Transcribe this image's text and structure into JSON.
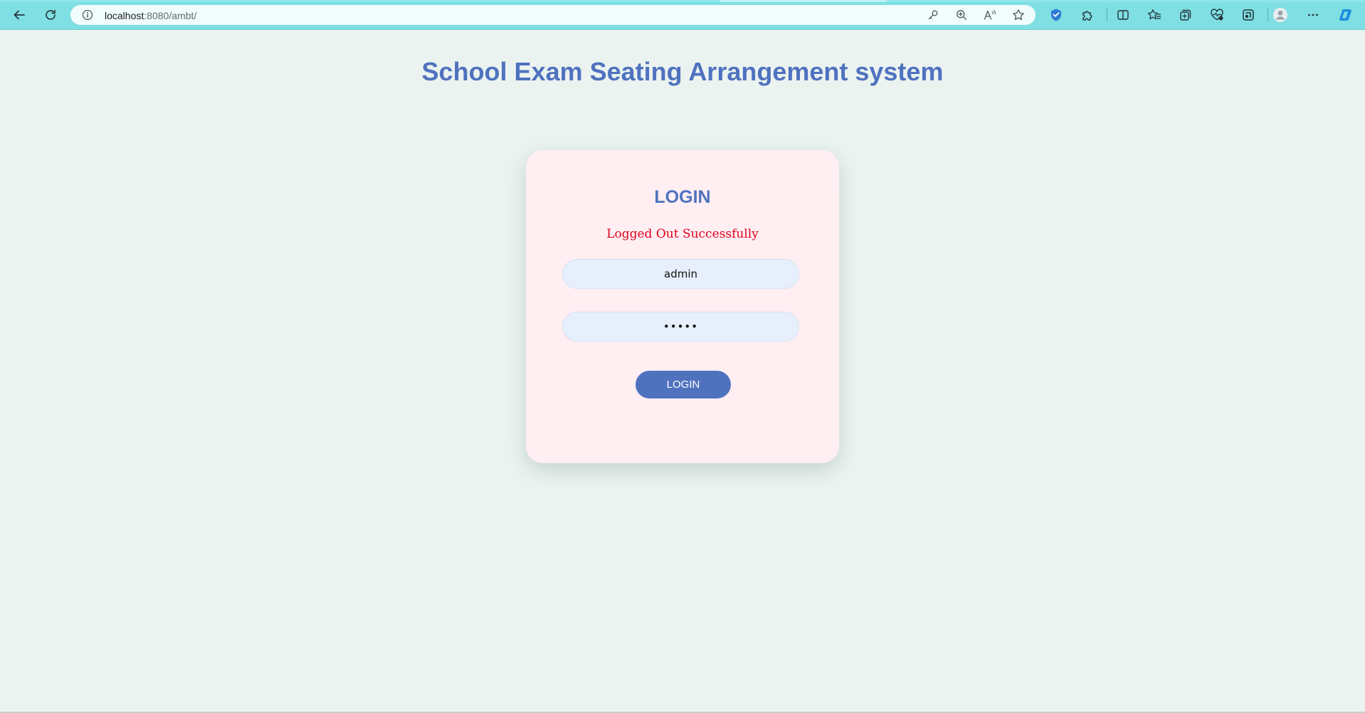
{
  "browser": {
    "url_host": "localhost",
    "url_path": ":8080/ambt/",
    "icons": {
      "back": "back-arrow-icon",
      "refresh": "refresh-icon",
      "site_info": "info-icon",
      "password": "key-icon",
      "zoom": "zoom-icon",
      "read_aloud": "read-aloud-icon",
      "favorite": "star-icon",
      "extension_shield": "extension-icon",
      "extensions": "puzzle-icon",
      "split_screen": "split-screen-icon",
      "favorites": "favorites-icon",
      "collections": "collections-icon",
      "browser_essentials": "heart-pulse-icon",
      "web_capture": "web-capture-icon",
      "profile": "profile-icon",
      "menu": "more-icon",
      "copilot": "copilot-icon"
    },
    "accent": "#7fdfe3"
  },
  "page": {
    "title": "School Exam Seating Arrangement system",
    "background": "#ebf3f0"
  },
  "login": {
    "heading": "LOGIN",
    "status_message": "Logged Out Successfully",
    "username_value": "admin",
    "password_value": "admin",
    "button_label": "LOGIN",
    "accent": "#4f72bf",
    "card_background": "#ffeef2",
    "status_color": "#e0001a"
  }
}
